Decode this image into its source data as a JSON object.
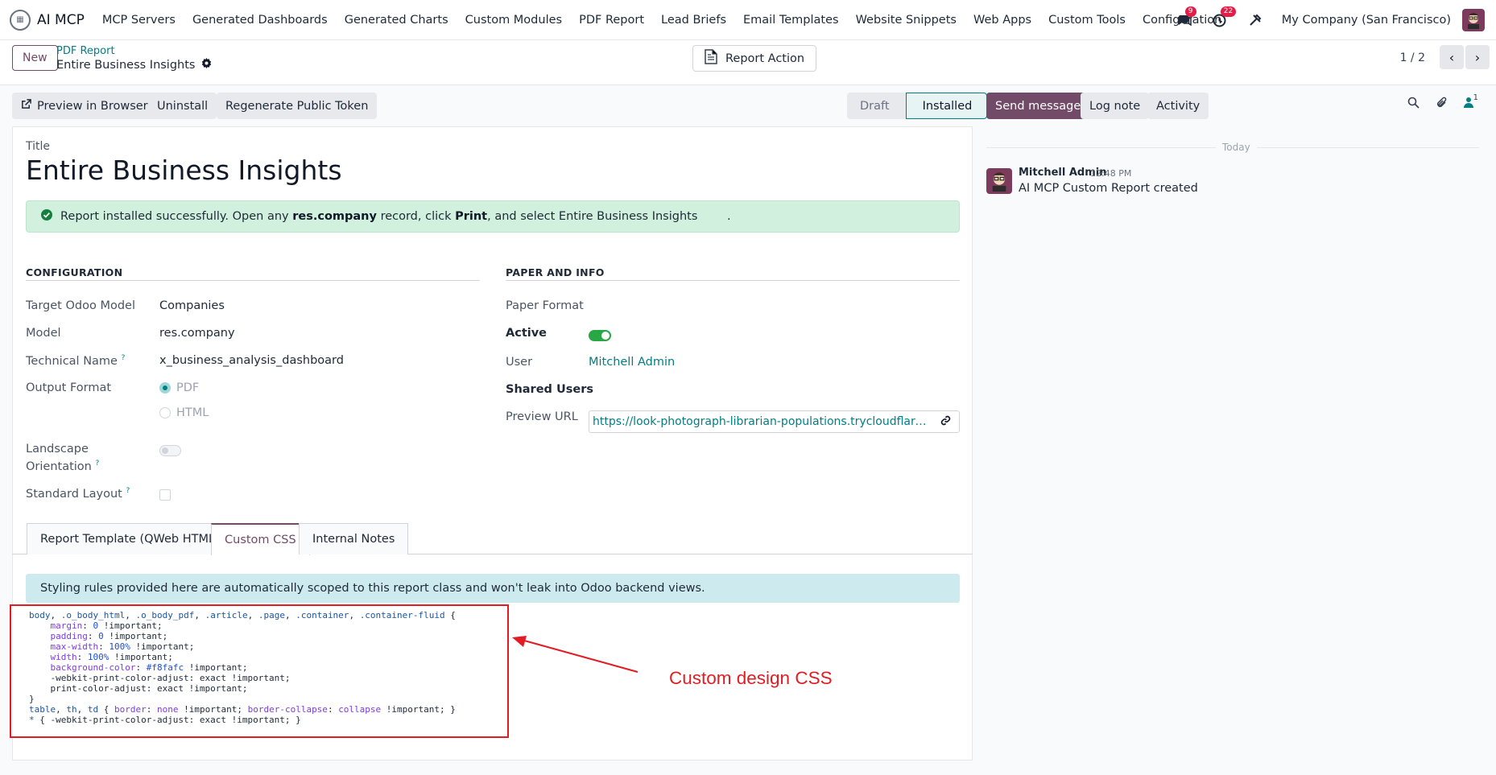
{
  "app": {
    "brand": "AI MCP",
    "menu": [
      "MCP Servers",
      "Generated Dashboards",
      "Generated Charts",
      "Custom Modules",
      "PDF Report",
      "Lead Briefs",
      "Email Templates",
      "Website Snippets",
      "Web Apps",
      "Custom Tools",
      "Configuration"
    ],
    "messages_badge": "9",
    "activity_badge": "22",
    "company": "My Company (San Francisco)"
  },
  "control_panel": {
    "new_label": "New",
    "breadcrumb_parent": "PDF Report",
    "breadcrumb_current": "Entire Business Insights",
    "report_action_label": "Report Action",
    "pager": "1 / 2"
  },
  "form_buttons": {
    "preview": "Preview in Browser",
    "uninstall": "Uninstall",
    "regenerate": "Regenerate Public Token"
  },
  "status": {
    "draft": "Draft",
    "installed": "Installed"
  },
  "chatter": {
    "send_message": "Send message",
    "log_note": "Log note",
    "activity": "Activity",
    "followers_count": "1",
    "today": "Today",
    "message": {
      "author": "Mitchell Admin",
      "time": "12:48 PM",
      "body": "AI MCP Custom Report created"
    }
  },
  "form": {
    "title_label": "Title",
    "title_value": "Entire Business Insights",
    "alert_prefix": "Report installed successfully. Open any",
    "alert_model": "res.company",
    "alert_mid": "record, click",
    "alert_print": "Print",
    "alert_suffix": ", and select Entire Business Insights",
    "alert_end": ".",
    "config_section": "CONFIGURATION",
    "paper_section": "PAPER AND INFO",
    "target_model_label": "Target Odoo Model",
    "target_model_value": "Companies",
    "model_label": "Model",
    "model_value": "res.company",
    "tech_name_label": "Technical Name",
    "tech_name_value": "x_business_analysis_dashboard",
    "output_format_label": "Output Format",
    "output_pdf": "PDF",
    "output_html": "HTML",
    "landscape_label_1": "Landscape",
    "landscape_label_2": "Orientation",
    "standard_layout_label": "Standard Layout",
    "help_mark": "?",
    "paper_format_label": "Paper Format",
    "active_label": "Active",
    "user_label": "User",
    "user_value": "Mitchell Admin",
    "shared_users_label": "Shared Users",
    "preview_url_label": "Preview URL",
    "preview_url_value": "https://look-photograph-librarian-populations.trycloudflare.co..."
  },
  "tabs": {
    "template": "Report Template (QWeb HTML)",
    "css": "Custom CSS",
    "notes": "Internal Notes"
  },
  "css_tab": {
    "info": "Styling rules provided here are automatically scoped to this report class and won't leak into Odoo backend views.",
    "annotation": "Custom design CSS"
  },
  "colors": {
    "brand": "#714b67",
    "link": "#017e84",
    "annotation": "#e11d23"
  }
}
